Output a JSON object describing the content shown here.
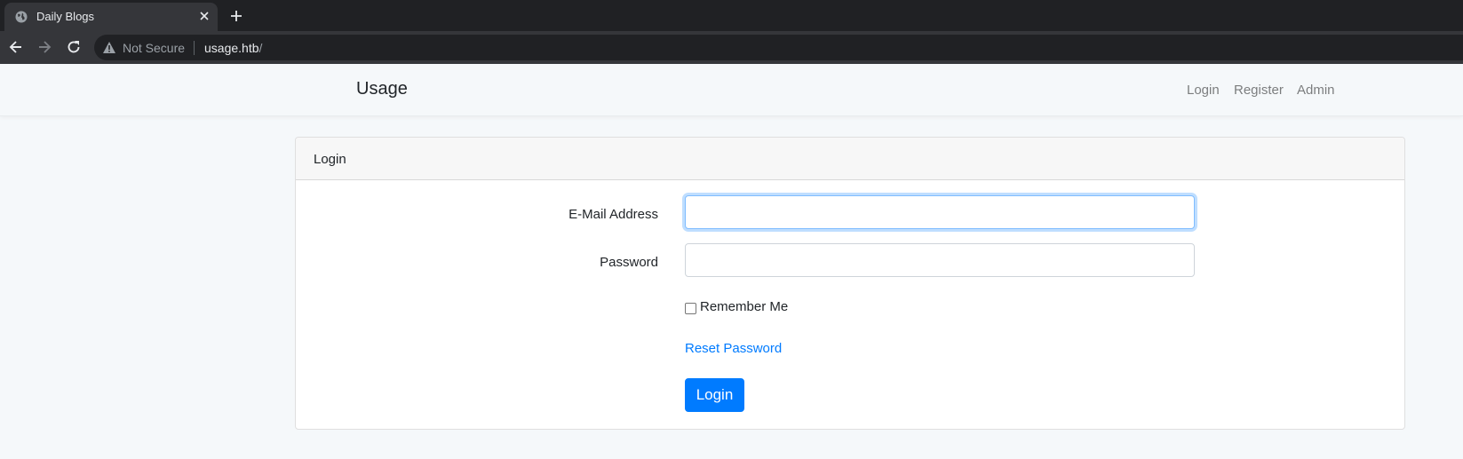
{
  "browser": {
    "tab_title": "Daily Blogs",
    "security_label": "Not Secure",
    "url_host": "usage.htb",
    "url_path": "/"
  },
  "navbar": {
    "brand": "Usage",
    "links": [
      "Login",
      "Register",
      "Admin"
    ]
  },
  "card": {
    "header": "Login",
    "email_label": "E-Mail Address",
    "email_value": "",
    "password_label": "Password",
    "password_value": "",
    "remember_label": "Remember Me",
    "remember_checked": false,
    "reset_link": "Reset Password",
    "submit_label": "Login"
  },
  "colors": {
    "primary": "#007bff",
    "page_bg": "#f5f8fa",
    "chrome_dark": "#202124",
    "chrome_toolbar": "#35363a"
  }
}
